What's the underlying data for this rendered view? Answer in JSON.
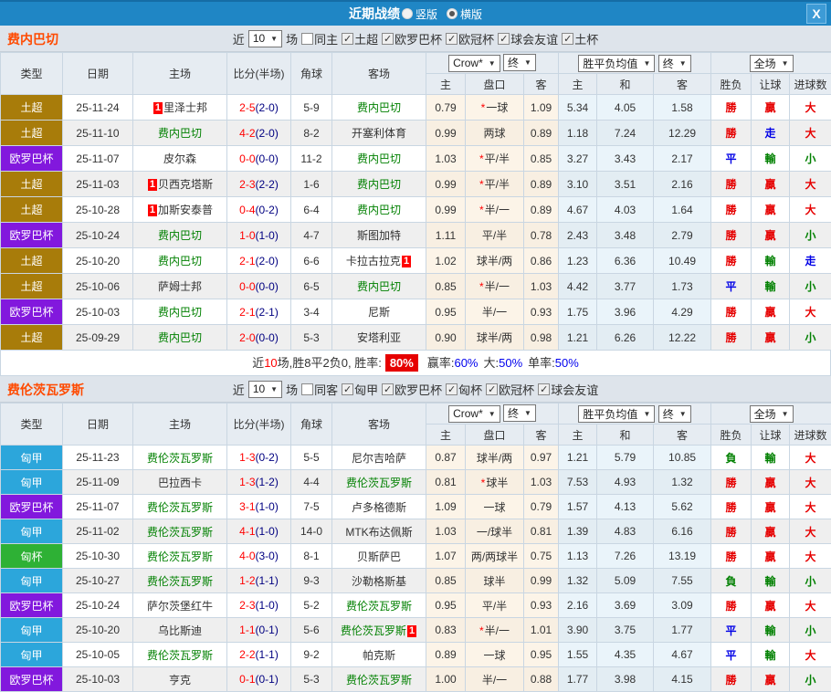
{
  "topbar": {
    "title": "近期战绩",
    "vertical": "竖版",
    "horizontal": "横版",
    "close": "X"
  },
  "colors": {
    "topbar_blue": "#1F86C5",
    "team_orange": "#FF4A00",
    "leagues": {
      "土超": "#A87C0A",
      "欧罗巴杯": "#8218DD",
      "匈甲": "#2CA6DB",
      "匈杯": "#2EB135"
    },
    "results": {
      "red": "#E60000",
      "blue": "#0000E6",
      "green": "#008000"
    },
    "odds_bg": "#FCF4E8",
    "avg_bg": "#EAF4FA",
    "header_bg": "#E6ECF2"
  },
  "table_header": {
    "type": "类型",
    "date": "日期",
    "home": "主场",
    "score": "比分(半场)",
    "corner": "角球",
    "away": "客场",
    "odds_company": "Crow*",
    "final1": "终",
    "avg": "胜平负均值",
    "final2": "终",
    "scope": "全场",
    "h": "主",
    "hcp": "盘口",
    "a": "客",
    "h2": "主",
    "d": "和",
    "a2": "客",
    "res": "胜负",
    "let": "让球",
    "goals": "进球数"
  },
  "sections": [
    {
      "team": "费内巴切",
      "filter": {
        "near": "近",
        "count": "10",
        "matches": "场",
        "same": "同主",
        "leagues": [
          "土超",
          "欧罗巴杯",
          "欧冠杯",
          "球会友谊",
          "土杯"
        ]
      },
      "rows": [
        {
          "league": "土超",
          "date": "25-11-24",
          "home": "里泽士邦",
          "homeBadge": "1",
          "homeGreen": false,
          "score": "2-5",
          "half": "(2-0)",
          "corner": "5-9",
          "away": "费内巴切",
          "awayGreen": true,
          "awayBadge": "",
          "o1": "0.79",
          "star": true,
          "hcp": "一球",
          "o2": "1.09",
          "m1": "5.34",
          "m2": "4.05",
          "m3": "1.58",
          "r1": "勝",
          "r1c": "red",
          "r2": "贏",
          "r2c": "red",
          "r3": "大",
          "r3c": "red"
        },
        {
          "league": "土超",
          "date": "25-11-10",
          "home": "费内巴切",
          "homeBadge": "",
          "homeGreen": true,
          "score": "4-2",
          "half": "(2-0)",
          "corner": "8-2",
          "away": "开塞利体育",
          "awayGreen": false,
          "awayBadge": "",
          "o1": "0.99",
          "star": false,
          "hcp": "两球",
          "o2": "0.89",
          "m1": "1.18",
          "m2": "7.24",
          "m3": "12.29",
          "r1": "勝",
          "r1c": "red",
          "r2": "走",
          "r2c": "blue",
          "r3": "大",
          "r3c": "red"
        },
        {
          "league": "欧罗巴杯",
          "date": "25-11-07",
          "home": "皮尔森",
          "homeBadge": "",
          "homeGreen": false,
          "score": "0-0",
          "half": "(0-0)",
          "corner": "11-2",
          "away": "费内巴切",
          "awayGreen": true,
          "awayBadge": "",
          "o1": "1.03",
          "star": true,
          "hcp": "平/半",
          "o2": "0.85",
          "m1": "3.27",
          "m2": "3.43",
          "m3": "2.17",
          "r1": "平",
          "r1c": "blue",
          "r2": "輸",
          "r2c": "green",
          "r3": "小",
          "r3c": "green"
        },
        {
          "league": "土超",
          "date": "25-11-03",
          "home": "贝西克塔斯",
          "homeBadge": "1",
          "homeGreen": false,
          "score": "2-3",
          "half": "(2-2)",
          "corner": "1-6",
          "away": "费内巴切",
          "awayGreen": true,
          "awayBadge": "",
          "o1": "0.99",
          "star": true,
          "hcp": "平/半",
          "o2": "0.89",
          "m1": "3.10",
          "m2": "3.51",
          "m3": "2.16",
          "r1": "勝",
          "r1c": "red",
          "r2": "贏",
          "r2c": "red",
          "r3": "大",
          "r3c": "red"
        },
        {
          "league": "土超",
          "date": "25-10-28",
          "home": "加斯安泰普",
          "homeBadge": "1",
          "homeGreen": false,
          "score": "0-4",
          "half": "(0-2)",
          "corner": "6-4",
          "away": "费内巴切",
          "awayGreen": true,
          "awayBadge": "",
          "o1": "0.99",
          "star": true,
          "hcp": "半/一",
          "o2": "0.89",
          "m1": "4.67",
          "m2": "4.03",
          "m3": "1.64",
          "r1": "勝",
          "r1c": "red",
          "r2": "贏",
          "r2c": "red",
          "r3": "大",
          "r3c": "red"
        },
        {
          "league": "欧罗巴杯",
          "date": "25-10-24",
          "home": "费内巴切",
          "homeBadge": "",
          "homeGreen": true,
          "score": "1-0",
          "half": "(1-0)",
          "corner": "4-7",
          "away": "斯图加特",
          "awayGreen": false,
          "awayBadge": "",
          "o1": "1.11",
          "star": false,
          "hcp": "平/半",
          "o2": "0.78",
          "m1": "2.43",
          "m2": "3.48",
          "m3": "2.79",
          "r1": "勝",
          "r1c": "red",
          "r2": "贏",
          "r2c": "red",
          "r3": "小",
          "r3c": "green"
        },
        {
          "league": "土超",
          "date": "25-10-20",
          "home": "费内巴切",
          "homeBadge": "",
          "homeGreen": true,
          "score": "2-1",
          "half": "(2-0)",
          "corner": "6-6",
          "away": "卡拉古拉克",
          "awayGreen": false,
          "awayBadge": "1",
          "o1": "1.02",
          "star": false,
          "hcp": "球半/两",
          "o2": "0.86",
          "m1": "1.23",
          "m2": "6.36",
          "m3": "10.49",
          "r1": "勝",
          "r1c": "red",
          "r2": "輸",
          "r2c": "green",
          "r3": "走",
          "r3c": "blue"
        },
        {
          "league": "土超",
          "date": "25-10-06",
          "home": "萨姆士邦",
          "homeBadge": "",
          "homeGreen": false,
          "score": "0-0",
          "half": "(0-0)",
          "corner": "6-5",
          "away": "费内巴切",
          "awayGreen": true,
          "awayBadge": "",
          "o1": "0.85",
          "star": true,
          "hcp": "半/一",
          "o2": "1.03",
          "m1": "4.42",
          "m2": "3.77",
          "m3": "1.73",
          "r1": "平",
          "r1c": "blue",
          "r2": "輸",
          "r2c": "green",
          "r3": "小",
          "r3c": "green"
        },
        {
          "league": "欧罗巴杯",
          "date": "25-10-03",
          "home": "费内巴切",
          "homeBadge": "",
          "homeGreen": true,
          "score": "2-1",
          "half": "(2-1)",
          "corner": "3-4",
          "away": "尼斯",
          "awayGreen": false,
          "awayBadge": "",
          "o1": "0.95",
          "star": false,
          "hcp": "半/一",
          "o2": "0.93",
          "m1": "1.75",
          "m2": "3.96",
          "m3": "4.29",
          "r1": "勝",
          "r1c": "red",
          "r2": "贏",
          "r2c": "red",
          "r3": "大",
          "r3c": "red"
        },
        {
          "league": "土超",
          "date": "25-09-29",
          "home": "费内巴切",
          "homeBadge": "",
          "homeGreen": true,
          "score": "2-0",
          "half": "(0-0)",
          "corner": "5-3",
          "away": "安塔利亚",
          "awayGreen": false,
          "awayBadge": "",
          "o1": "0.90",
          "star": false,
          "hcp": "球半/两",
          "o2": "0.98",
          "m1": "1.21",
          "m2": "6.26",
          "m3": "12.22",
          "r1": "勝",
          "r1c": "red",
          "r2": "贏",
          "r2c": "red",
          "r3": "小",
          "r3c": "green"
        }
      ],
      "summary": {
        "pre": "近",
        "num": "10",
        "t1": "场,胜8平2负0, 胜率:",
        "rate": "80%",
        "t2": "赢率:",
        "v1": "60%",
        "t3": "大:",
        "v2": "50%",
        "t4": "单率:",
        "v3": "50%"
      }
    },
    {
      "team": "费伦茨瓦罗斯",
      "filter": {
        "near": "近",
        "count": "10",
        "matches": "场",
        "same": "同客",
        "leagues": [
          "匈甲",
          "欧罗巴杯",
          "匈杯",
          "欧冠杯",
          "球会友谊"
        ]
      },
      "rows": [
        {
          "league": "匈甲",
          "date": "25-11-23",
          "home": "费伦茨瓦罗斯",
          "homeBadge": "",
          "homeGreen": true,
          "score": "1-3",
          "half": "(0-2)",
          "corner": "5-5",
          "away": "尼尔吉哈萨",
          "awayGreen": false,
          "awayBadge": "",
          "o1": "0.87",
          "star": false,
          "hcp": "球半/两",
          "o2": "0.97",
          "m1": "1.21",
          "m2": "5.79",
          "m3": "10.85",
          "r1": "負",
          "r1c": "green",
          "r2": "輸",
          "r2c": "green",
          "r3": "大",
          "r3c": "red"
        },
        {
          "league": "匈甲",
          "date": "25-11-09",
          "home": "巴拉西卡",
          "homeBadge": "",
          "homeGreen": false,
          "score": "1-3",
          "half": "(1-2)",
          "corner": "4-4",
          "away": "费伦茨瓦罗斯",
          "awayGreen": true,
          "awayBadge": "",
          "o1": "0.81",
          "star": true,
          "hcp": "球半",
          "o2": "1.03",
          "m1": "7.53",
          "m2": "4.93",
          "m3": "1.32",
          "r1": "勝",
          "r1c": "red",
          "r2": "贏",
          "r2c": "red",
          "r3": "大",
          "r3c": "red"
        },
        {
          "league": "欧罗巴杯",
          "date": "25-11-07",
          "home": "费伦茨瓦罗斯",
          "homeBadge": "",
          "homeGreen": true,
          "score": "3-1",
          "half": "(1-0)",
          "corner": "7-5",
          "away": "卢多格德斯",
          "awayGreen": false,
          "awayBadge": "",
          "o1": "1.09",
          "star": false,
          "hcp": "一球",
          "o2": "0.79",
          "m1": "1.57",
          "m2": "4.13",
          "m3": "5.62",
          "r1": "勝",
          "r1c": "red",
          "r2": "贏",
          "r2c": "red",
          "r3": "大",
          "r3c": "red"
        },
        {
          "league": "匈甲",
          "date": "25-11-02",
          "home": "费伦茨瓦罗斯",
          "homeBadge": "",
          "homeGreen": true,
          "score": "4-1",
          "half": "(1-0)",
          "corner": "14-0",
          "away": "MTK布达佩斯",
          "awayGreen": false,
          "awayBadge": "",
          "o1": "1.03",
          "star": false,
          "hcp": "一/球半",
          "o2": "0.81",
          "m1": "1.39",
          "m2": "4.83",
          "m3": "6.16",
          "r1": "勝",
          "r1c": "red",
          "r2": "贏",
          "r2c": "red",
          "r3": "大",
          "r3c": "red"
        },
        {
          "league": "匈杯",
          "date": "25-10-30",
          "home": "费伦茨瓦罗斯",
          "homeBadge": "",
          "homeGreen": true,
          "score": "4-0",
          "half": "(3-0)",
          "corner": "8-1",
          "away": "贝斯萨巴",
          "awayGreen": false,
          "awayBadge": "",
          "o1": "1.07",
          "star": false,
          "hcp": "两/两球半",
          "o2": "0.75",
          "m1": "1.13",
          "m2": "7.26",
          "m3": "13.19",
          "r1": "勝",
          "r1c": "red",
          "r2": "贏",
          "r2c": "red",
          "r3": "大",
          "r3c": "red"
        },
        {
          "league": "匈甲",
          "date": "25-10-27",
          "home": "费伦茨瓦罗斯",
          "homeBadge": "",
          "homeGreen": true,
          "score": "1-2",
          "half": "(1-1)",
          "corner": "9-3",
          "away": "沙勒格斯基",
          "awayGreen": false,
          "awayBadge": "",
          "o1": "0.85",
          "star": false,
          "hcp": "球半",
          "o2": "0.99",
          "m1": "1.32",
          "m2": "5.09",
          "m3": "7.55",
          "r1": "負",
          "r1c": "green",
          "r2": "輸",
          "r2c": "green",
          "r3": "小",
          "r3c": "green"
        },
        {
          "league": "欧罗巴杯",
          "date": "25-10-24",
          "home": "萨尔茨堡红牛",
          "homeBadge": "",
          "homeGreen": false,
          "score": "2-3",
          "half": "(1-0)",
          "corner": "5-2",
          "away": "费伦茨瓦罗斯",
          "awayGreen": true,
          "awayBadge": "",
          "o1": "0.95",
          "star": false,
          "hcp": "平/半",
          "o2": "0.93",
          "m1": "2.16",
          "m2": "3.69",
          "m3": "3.09",
          "r1": "勝",
          "r1c": "red",
          "r2": "贏",
          "r2c": "red",
          "r3": "大",
          "r3c": "red"
        },
        {
          "league": "匈甲",
          "date": "25-10-20",
          "home": "乌比斯迪",
          "homeBadge": "",
          "homeGreen": false,
          "score": "1-1",
          "half": "(0-1)",
          "corner": "5-6",
          "away": "费伦茨瓦罗斯",
          "awayGreen": true,
          "awayBadge": "1",
          "o1": "0.83",
          "star": true,
          "hcp": "半/一",
          "o2": "1.01",
          "m1": "3.90",
          "m2": "3.75",
          "m3": "1.77",
          "r1": "平",
          "r1c": "blue",
          "r2": "輸",
          "r2c": "green",
          "r3": "小",
          "r3c": "green"
        },
        {
          "league": "匈甲",
          "date": "25-10-05",
          "home": "费伦茨瓦罗斯",
          "homeBadge": "",
          "homeGreen": true,
          "score": "2-2",
          "half": "(1-1)",
          "corner": "9-2",
          "away": "帕克斯",
          "awayGreen": false,
          "awayBadge": "",
          "o1": "0.89",
          "star": false,
          "hcp": "一球",
          "o2": "0.95",
          "m1": "1.55",
          "m2": "4.35",
          "m3": "4.67",
          "r1": "平",
          "r1c": "blue",
          "r2": "輸",
          "r2c": "green",
          "r3": "大",
          "r3c": "red"
        },
        {
          "league": "欧罗巴杯",
          "date": "25-10-03",
          "home": "亨克",
          "homeBadge": "",
          "homeGreen": false,
          "score": "0-1",
          "half": "(0-1)",
          "corner": "5-3",
          "away": "费伦茨瓦罗斯",
          "awayGreen": true,
          "awayBadge": "",
          "o1": "1.00",
          "star": false,
          "hcp": "半/一",
          "o2": "0.88",
          "m1": "1.77",
          "m2": "3.98",
          "m3": "4.15",
          "r1": "勝",
          "r1c": "red",
          "r2": "贏",
          "r2c": "red",
          "r3": "小",
          "r3c": "green"
        }
      ]
    }
  ]
}
